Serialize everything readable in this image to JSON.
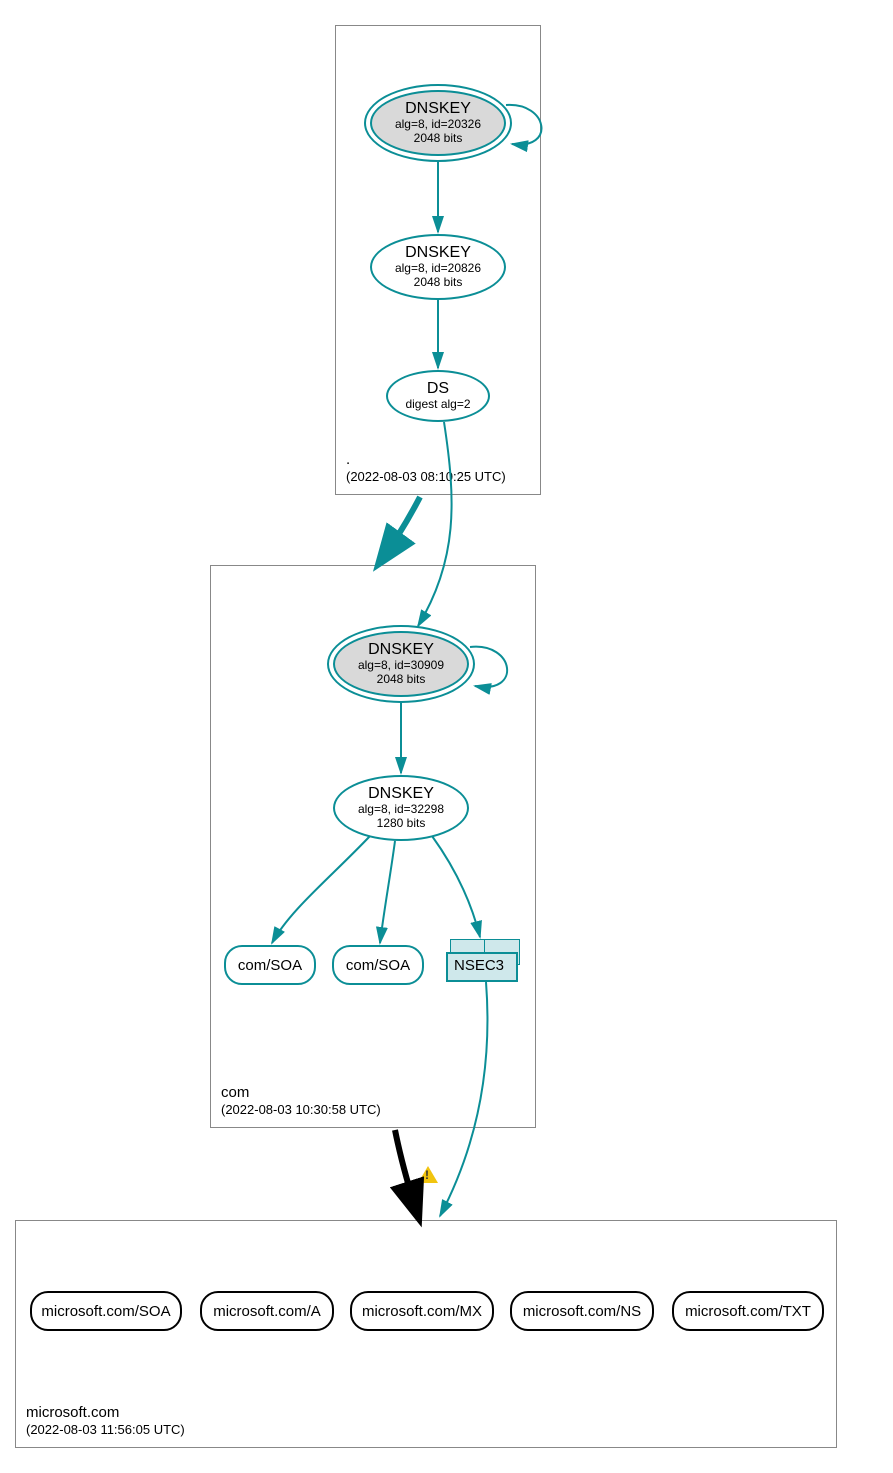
{
  "colors": {
    "teal": "#0b8e96",
    "zone_border": "#888888",
    "ksk_fill": "#d9d9d9",
    "nsec3_fill": "#cfe8eb"
  },
  "zones": {
    "root": {
      "name": ".",
      "timestamp": "(2022-08-03 08:10:25 UTC)"
    },
    "com": {
      "name": "com",
      "timestamp": "(2022-08-03 10:30:58 UTC)"
    },
    "microsoft": {
      "name": "microsoft.com",
      "timestamp": "(2022-08-03 11:56:05 UTC)"
    }
  },
  "nodes": {
    "root_ksk": {
      "title": "DNSKEY",
      "line1": "alg=8, id=20326",
      "line2": "2048 bits"
    },
    "root_zsk": {
      "title": "DNSKEY",
      "line1": "alg=8, id=20826",
      "line2": "2048 bits"
    },
    "root_ds": {
      "title": "DS",
      "line1": "digest alg=2"
    },
    "com_ksk": {
      "title": "DNSKEY",
      "line1": "alg=8, id=30909",
      "line2": "2048 bits"
    },
    "com_zsk": {
      "title": "DNSKEY",
      "line1": "alg=8, id=32298",
      "line2": "1280 bits"
    },
    "com_soa1": {
      "label": "com/SOA"
    },
    "com_soa2": {
      "label": "com/SOA"
    },
    "nsec3": {
      "label": "NSEC3"
    }
  },
  "rrsets": {
    "soa": "microsoft.com/SOA",
    "a": "microsoft.com/A",
    "mx": "microsoft.com/MX",
    "ns": "microsoft.com/NS",
    "txt": "microsoft.com/TXT"
  },
  "warning": {
    "present": true,
    "meaning": "delegation-warning-icon"
  }
}
